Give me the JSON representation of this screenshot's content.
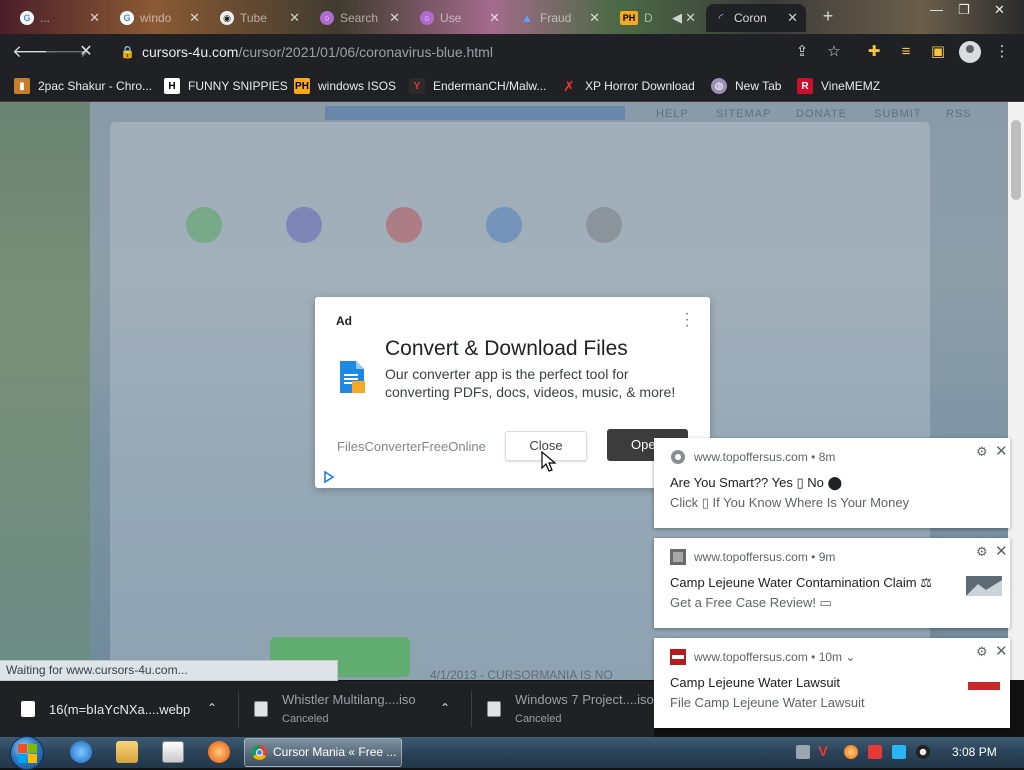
{
  "tabs": [
    {
      "label": "...",
      "favicon": "google-icon",
      "active": false
    },
    {
      "label": "windo",
      "favicon": "google-icon",
      "active": false
    },
    {
      "label": "Tube",
      "favicon": "tube-icon",
      "active": false
    },
    {
      "label": "Search",
      "favicon": "search-site-icon",
      "active": false
    },
    {
      "label": "Use",
      "favicon": "user-icon",
      "active": false
    },
    {
      "label": "Fraud",
      "favicon": "a-icon",
      "active": false
    },
    {
      "label": "D",
      "favicon": "ph-icon",
      "active": false
    },
    {
      "label": "Coron",
      "favicon": "loading-icon",
      "active": true
    }
  ],
  "window": {
    "minimize": "—",
    "maximize": "❐",
    "close": "✕"
  },
  "toolbar": {
    "url_host": "cursors-4u.com",
    "url_path": "/cursor/2021/01/06/coronavirus-blue.html"
  },
  "bookmarks": [
    {
      "label": "2pac Shakur - Chro...",
      "icon": "bookmark-icon"
    },
    {
      "label": "FUNNY SNIPPIES",
      "icon": "h-icon"
    },
    {
      "label": "windows ISOS",
      "icon": "ph-icon"
    },
    {
      "label": "EndermanCH/Malw...",
      "icon": "youtube-icon"
    },
    {
      "label": "XP Horror Download",
      "icon": "x-icon"
    },
    {
      "label": "New Tab",
      "icon": "globe-icon"
    },
    {
      "label": "VineMEMZ",
      "icon": "r-icon"
    }
  ],
  "page": {
    "nav": [
      "HELP",
      "SITEMAP",
      "DONATE",
      "SUBMIT",
      "RSS"
    ],
    "footer": "4/1/2013 - CURSORMANIA IS NO"
  },
  "ad": {
    "label": "Ad",
    "title": "Convert & Download Files",
    "description": "Our converter app is the perfect tool for converting PDFs, docs, videos, music, & more!",
    "advertiser": "FilesConverterFreeOnline",
    "close_label": "Close",
    "open_label": "Open"
  },
  "notifications": [
    {
      "site": "www.topoffersus.com",
      "time": "• 8m",
      "title": "Are You Smart?? Yes ▯ No ⬤",
      "body": "Click ▯ If You Know Where Is Your Money",
      "has_thumb": false
    },
    {
      "site": "www.topoffersus.com",
      "time": "• 9m",
      "title": "Camp Lejeune Water Contamination Claim ⚖",
      "body": "Get a Free Case Review! ▭",
      "has_thumb": true
    },
    {
      "site": "www.topoffersus.com",
      "time": "• 10m ⌄",
      "title": "Camp Lejeune Water Lawsuit",
      "body": "File Camp Lejeune Water Lawsuit",
      "has_thumb": true
    }
  ],
  "status": "Waiting for www.cursors-4u.com...",
  "downloads": [
    {
      "name": "16(m=bIaYcNXa....webp",
      "status": ""
    },
    {
      "name": "Whistler Multilang....iso",
      "status": "Canceled"
    },
    {
      "name": "Windows 7 Project....iso",
      "status": "Canceled"
    }
  ],
  "taskbar": {
    "active_task": "Cursor Mania « Free ...",
    "clock": "3:08 PM"
  },
  "colors": {
    "chrome_dark": "#202124",
    "dialog_button_dark": "#3c3c3c",
    "taskbar": "#2b4358"
  }
}
